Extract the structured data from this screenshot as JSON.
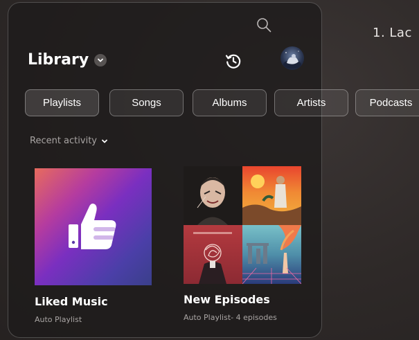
{
  "background": {
    "text": "1. Lac"
  },
  "header": {
    "title": "Library",
    "icons": [
      "search-icon",
      "chevron-down-icon",
      "history-icon",
      "avatar"
    ]
  },
  "chips": [
    {
      "label": "Playlists"
    },
    {
      "label": "Songs"
    },
    {
      "label": "Albums"
    },
    {
      "label": "Artists"
    },
    {
      "label": "Podcasts"
    }
  ],
  "sort": {
    "label": "Recent activity"
  },
  "tiles": [
    {
      "title": "Liked Music",
      "subtitle": "Auto Playlist",
      "icon": "thumbs-up-icon"
    },
    {
      "title": "New Episodes",
      "subtitle": "Auto Playlist- 4 episodes"
    }
  ],
  "colors": {
    "panel_bg": "#1e1b1b",
    "chip_border": "#6a6665",
    "secondary_text": "#a9a5a4",
    "liked_gradient_start": "#e76b5d",
    "liked_gradient_mid": "#7a2fc0",
    "liked_gradient_end": "#3a3f8a"
  }
}
